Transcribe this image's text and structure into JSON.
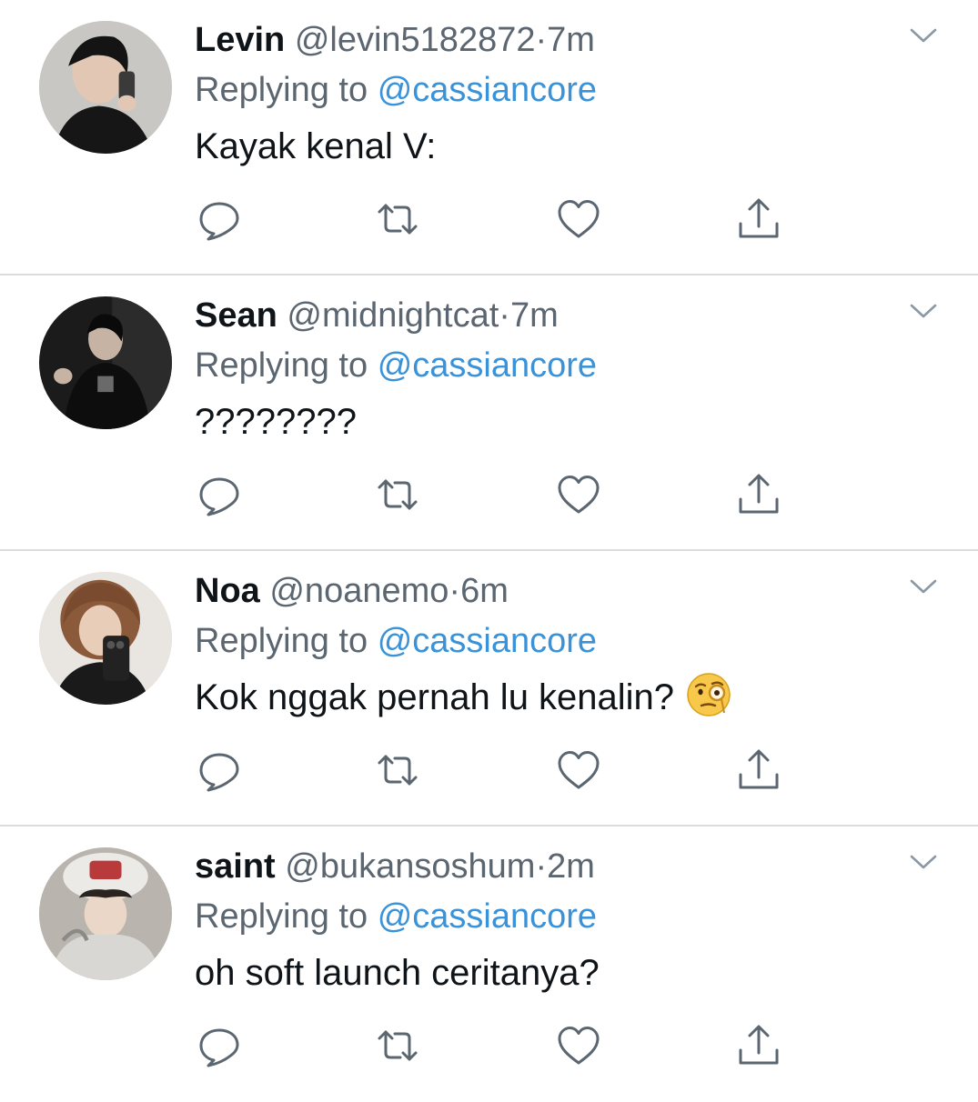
{
  "colors": {
    "text_primary": "#0f1419",
    "text_secondary": "#5b6670",
    "link_blue": "#3a93d8",
    "icon_gray": "#5b6670",
    "divider": "#d9dde0"
  },
  "tweets": [
    {
      "display_name": "Levin",
      "handle": "@levin5182872",
      "separator": "·",
      "time": "7m",
      "replying_label": "Replying to",
      "replying_to": "@cassiancore",
      "text": "Kayak kenal V:",
      "emoji": null,
      "icons": [
        "reply-icon",
        "retweet-icon",
        "like-icon",
        "share-icon",
        "chevron-down-icon"
      ]
    },
    {
      "display_name": "Sean",
      "handle": "@midnightcat",
      "separator": "·",
      "time": "7m",
      "replying_label": "Replying to",
      "replying_to": "@cassiancore",
      "text": "????????",
      "emoji": null,
      "icons": [
        "reply-icon",
        "retweet-icon",
        "like-icon",
        "share-icon",
        "chevron-down-icon"
      ]
    },
    {
      "display_name": "Noa",
      "handle": "@noanemo",
      "separator": "·",
      "time": "6m",
      "replying_label": "Replying to",
      "replying_to": "@cassiancore",
      "text": "Kok nggak pernah lu kenalin?",
      "emoji": "face-with-monocle-emoji",
      "icons": [
        "reply-icon",
        "retweet-icon",
        "like-icon",
        "share-icon",
        "chevron-down-icon"
      ]
    },
    {
      "display_name": "saint",
      "handle": "@bukansoshum",
      "separator": "·",
      "time": "2m",
      "replying_label": "Replying to",
      "replying_to": "@cassiancore",
      "text": "oh soft launch ceritanya?",
      "emoji": null,
      "icons": [
        "reply-icon",
        "retweet-icon",
        "like-icon",
        "share-icon",
        "chevron-down-icon"
      ]
    }
  ]
}
